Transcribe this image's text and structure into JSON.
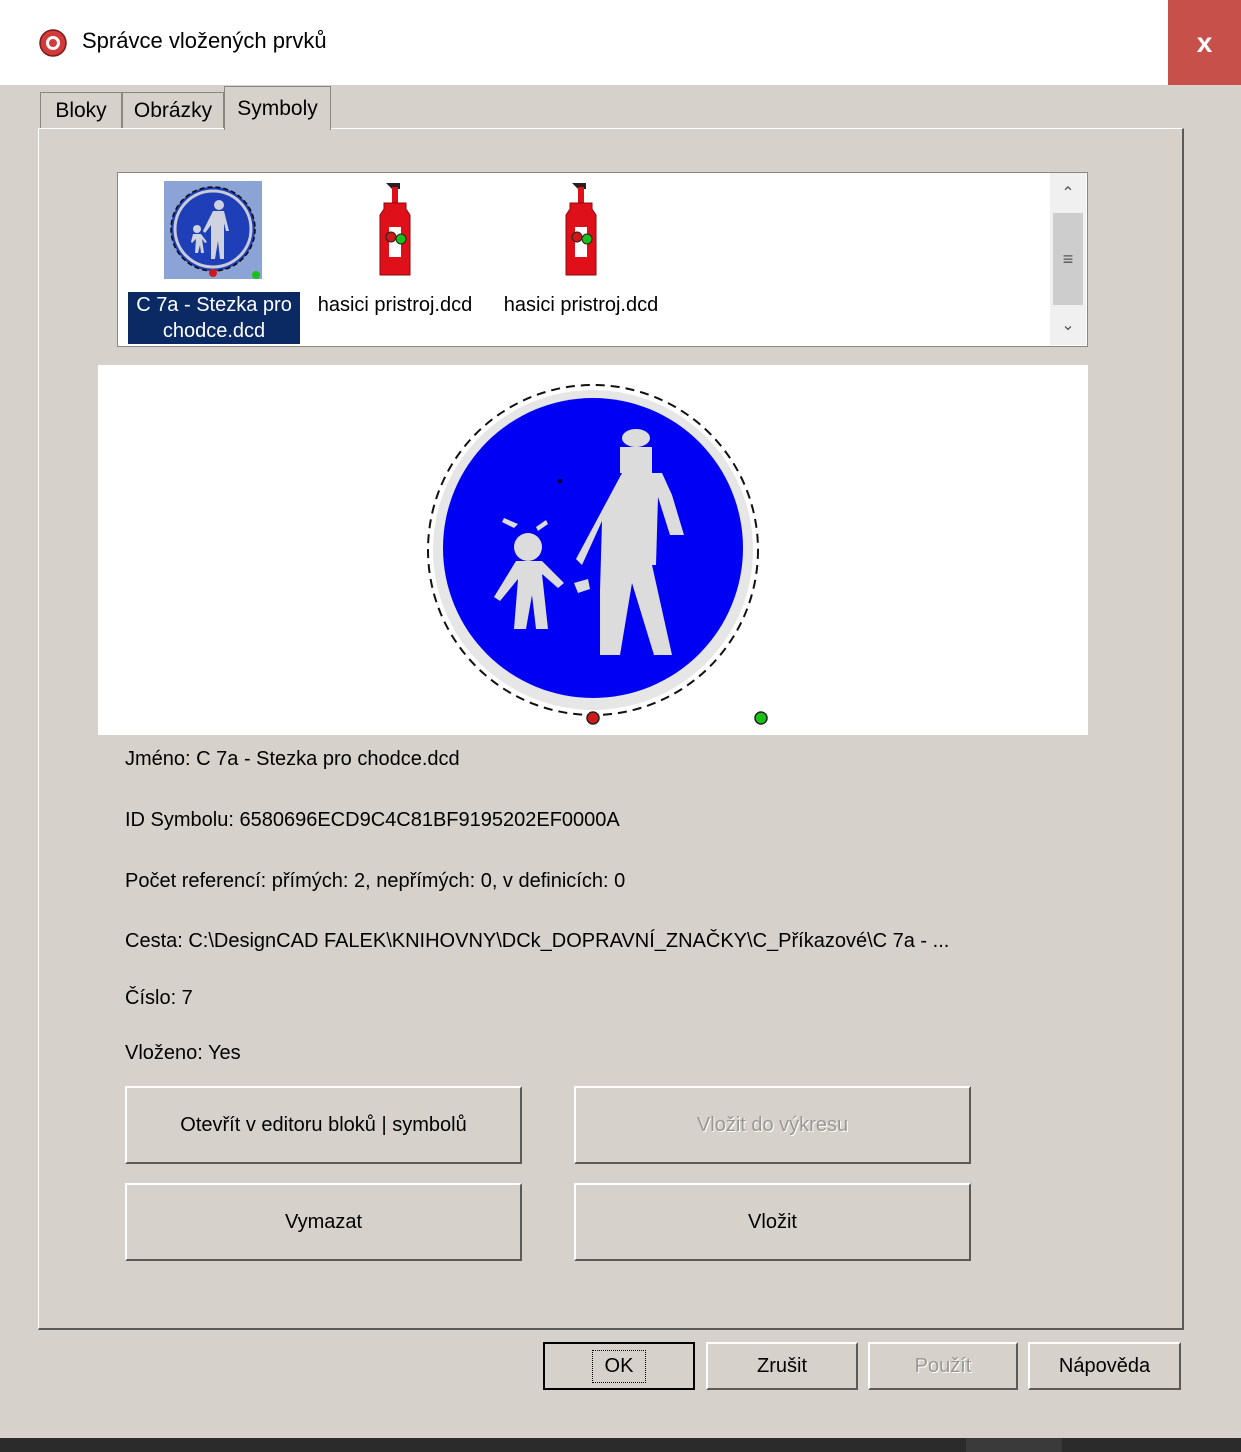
{
  "window": {
    "title": "Správce vložených prvků",
    "close_label": "x"
  },
  "tabs": [
    {
      "label": "Bloky",
      "active": false
    },
    {
      "label": "Obrázky",
      "active": false
    },
    {
      "label": "Symboly",
      "active": true
    }
  ],
  "list": {
    "items": [
      {
        "label": "C 7a - Stezka pro chodce.dcd",
        "icon": "pedestrian-path-sign-icon",
        "selected": true
      },
      {
        "label": "hasici pristroj.dcd",
        "icon": "fire-extinguisher-icon",
        "selected": false
      },
      {
        "label": "hasici pristroj.dcd",
        "icon": "fire-extinguisher-icon",
        "selected": false
      }
    ]
  },
  "info": {
    "name": "Jméno: C 7a - Stezka pro chodce.dcd",
    "id": "ID Symbolu: 6580696ECD9C4C81BF9195202EF0000A",
    "refs": "Počet referencí: přímých: 2, nepřímých: 0, v definicích: 0",
    "path": "Cesta: C:\\DesignCAD FALEK\\KNIHOVNY\\DCk_DOPRAVNÍ_ZNAČKY\\C_Příkazové\\C 7a - ...",
    "number": "Číslo: 7",
    "inserted": "Vloženo: Yes"
  },
  "actions": {
    "open_editor": "Otevřít v editoru bloků | symbolů",
    "insert_drawing": "Vložit do výkresu",
    "delete": "Vymazat",
    "insert": "Vložit"
  },
  "footer": {
    "ok": "OK",
    "cancel": "Zrušit",
    "apply": "Použít",
    "help": "Nápověda"
  },
  "colors": {
    "sign_blue": "#0000f5",
    "extinguisher_red": "#e0101a",
    "selection": "#0b2a64",
    "close": "#c8504a"
  }
}
